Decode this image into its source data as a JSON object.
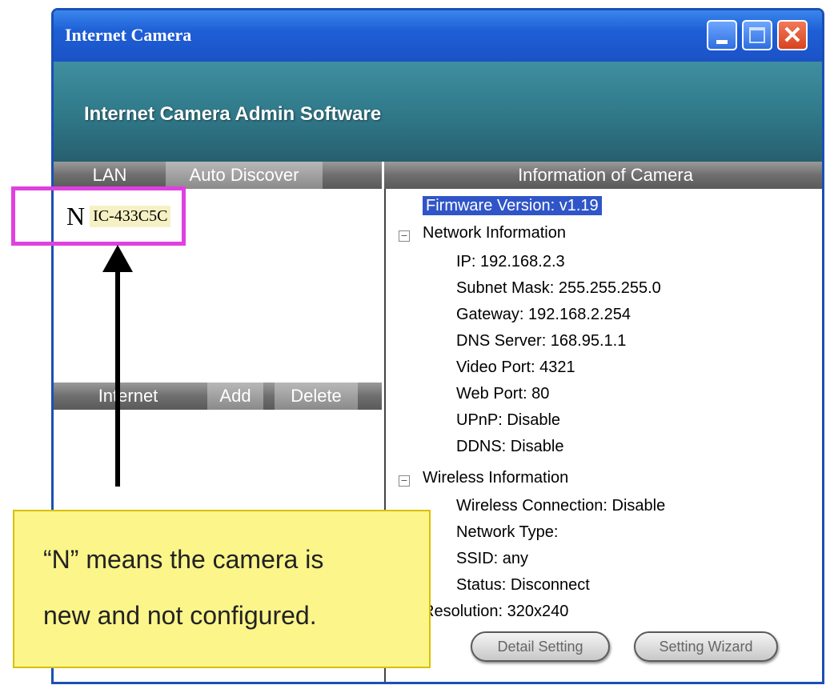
{
  "window": {
    "title": "Internet Camera",
    "banner": "Internet Camera Admin Software",
    "close_glyph": "✕"
  },
  "lan_bar": {
    "tab_lan": "LAN",
    "tab_auto_discover": "Auto Discover"
  },
  "info_bar": {
    "title": "Information of Camera"
  },
  "internet_bar": {
    "label": "Internet",
    "add": "Add",
    "delete": "Delete"
  },
  "device_list": [
    {
      "status": "N",
      "name": "IC-433C5C"
    }
  ],
  "camera_info": {
    "firmware": "Firmware Version: v1.19",
    "network_header": "Network Information",
    "network": [
      "IP:  192.168.2.3",
      "Subnet Mask:  255.255.255.0",
      "Gateway:  192.168.2.254",
      "DNS Server:  168.95.1.1",
      "Video Port:  4321",
      "Web Port:  80",
      "UPnP:  Disable",
      "DDNS:  Disable"
    ],
    "wireless_header": "Wireless Information",
    "wireless": [
      "Wireless Connection: Disable",
      "Network Type:",
      "SSID: any",
      "Status: Disconnect"
    ],
    "resolution": "Resolution: 320x240"
  },
  "buttons": {
    "detail_setting": "Detail Setting",
    "setting_wizard": "Setting Wizard"
  },
  "callout": {
    "line1": "“N” means the camera is",
    "line2": "new and not configured."
  }
}
